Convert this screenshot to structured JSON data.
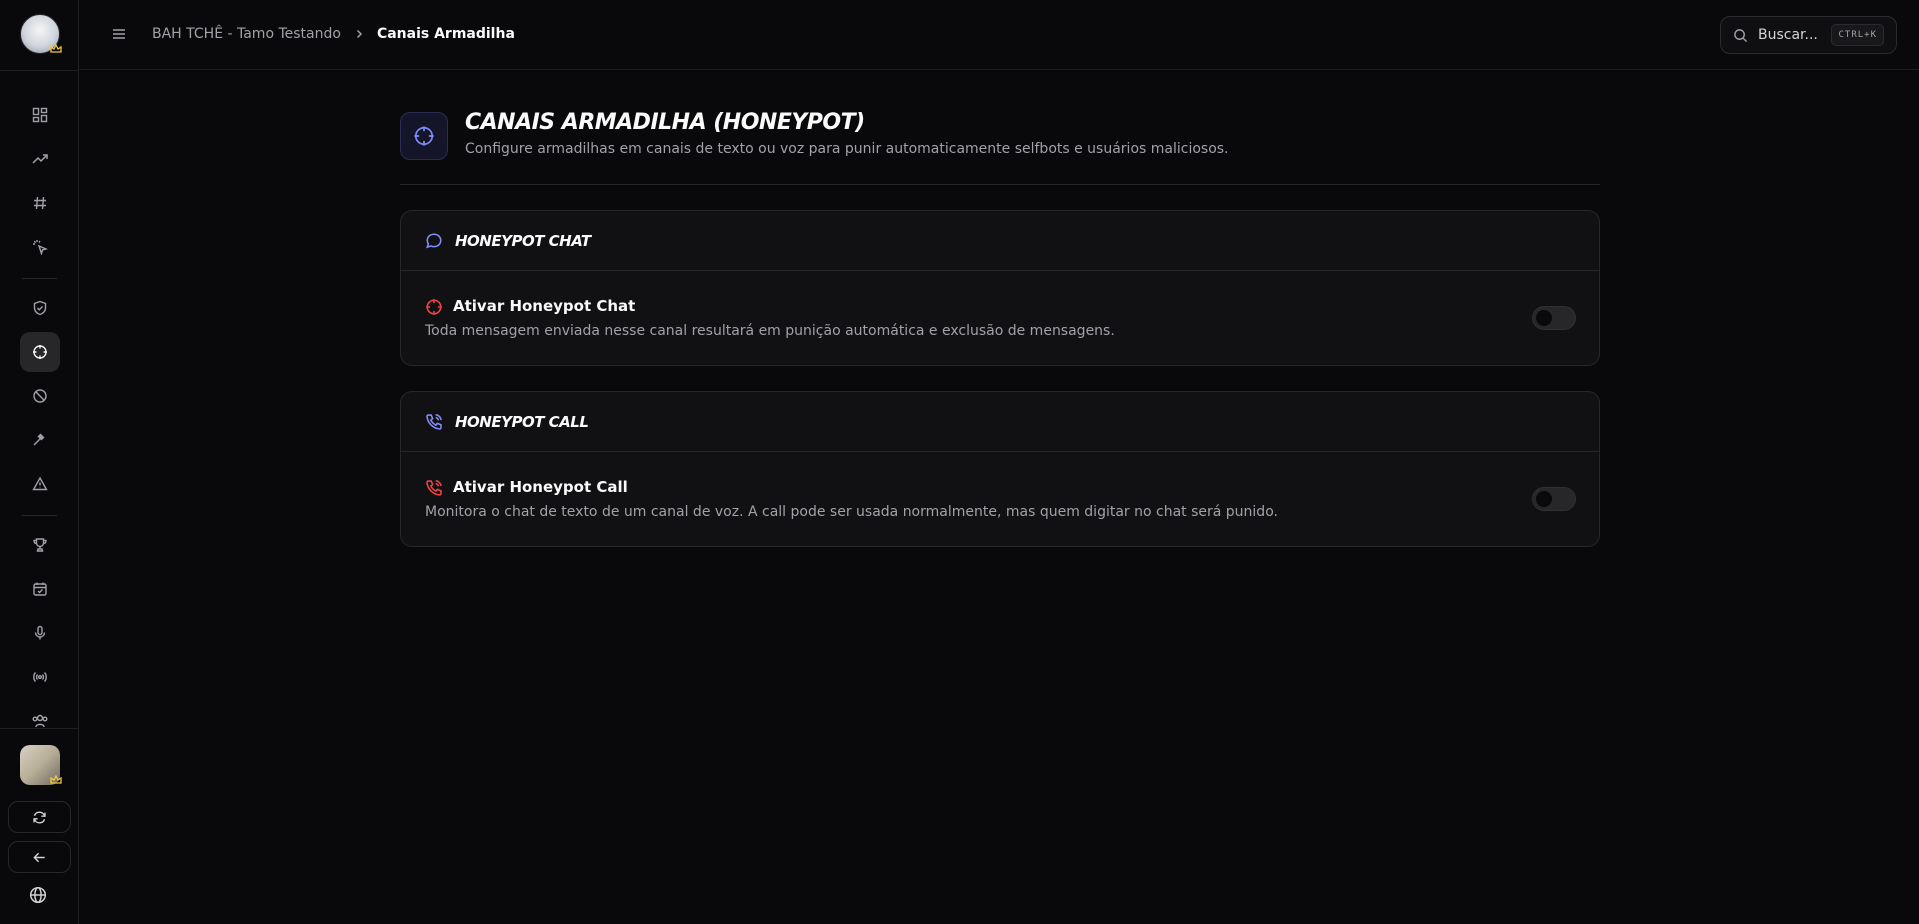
{
  "sidebar": {
    "nav_icons": [
      "dashboard-icon",
      "trending-icon",
      "hash-icon",
      "sparkle-click-icon",
      "shield-check-icon",
      "crosshair-icon",
      "ban-icon",
      "gavel-icon",
      "alert-triangle-icon",
      "trophy-icon",
      "calendar-icon",
      "microphone-icon",
      "broadcast-icon",
      "users-icon"
    ],
    "active_item": "crosshair-icon",
    "actions": [
      "refresh-icon",
      "back-arrow-icon"
    ],
    "footer_icon": "globe-icon"
  },
  "header": {
    "breadcrumb": {
      "server": "BAH TCHÊ - Tamo Testando",
      "current": "Canais Armadilha"
    },
    "search": {
      "placeholder": "Buscar...",
      "shortcut": "CTRL+K"
    }
  },
  "page": {
    "title": "CANAIS ARMADILHA (HONEYPOT)",
    "subtitle": "Configure armadilhas em canais de texto ou voz para punir automaticamente selfbots e usuários maliciosos.",
    "accent_color": "#818cf8",
    "danger_color": "#ef4444"
  },
  "cards": [
    {
      "title": "HONEYPOT CHAT",
      "option_title": "Ativar Honeypot Chat",
      "option_desc": "Toda mensagem enviada nesse canal resultará em punição automática e exclusão de mensagens.",
      "enabled": false
    },
    {
      "title": "HONEYPOT CALL",
      "option_title": "Ativar Honeypot Call",
      "option_desc": "Monitora o chat de texto de um canal de voz. A call pode ser usada normalmente, mas quem digitar no chat será punido.",
      "enabled": false
    }
  ]
}
